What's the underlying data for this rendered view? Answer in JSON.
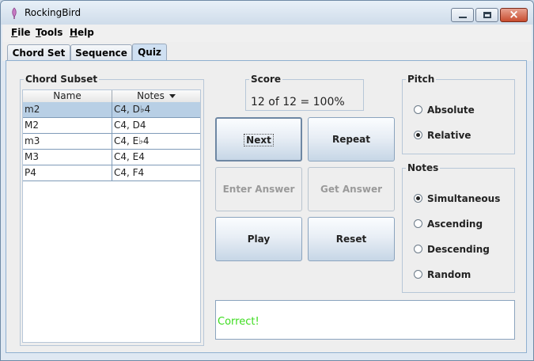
{
  "window": {
    "title": "RockingBird"
  },
  "menu": [
    {
      "label": "File",
      "mnemonic": "F",
      "rest": "ile"
    },
    {
      "label": "Tools",
      "mnemonic": "T",
      "rest": "ools"
    },
    {
      "label": "Help",
      "mnemonic": "H",
      "rest": "elp"
    }
  ],
  "tabs": [
    {
      "label": "Chord Set",
      "active": false
    },
    {
      "label": "Sequence",
      "active": false
    },
    {
      "label": "Quiz",
      "active": true
    }
  ],
  "chord_subset": {
    "title": "Chord Subset",
    "columns": {
      "name": "Name",
      "notes": "Notes"
    },
    "rows": [
      {
        "name": "m2",
        "notes": "C4, D♭4",
        "selected": true
      },
      {
        "name": "M2",
        "notes": "C4, D4",
        "selected": false
      },
      {
        "name": "m3",
        "notes": "C4, E♭4",
        "selected": false
      },
      {
        "name": "M3",
        "notes": "C4, E4",
        "selected": false
      },
      {
        "name": "P4",
        "notes": "C4, F4",
        "selected": false
      }
    ]
  },
  "score": {
    "title": "Score",
    "text": "12 of 12 = 100%"
  },
  "buttons": {
    "next": "Next",
    "repeat": "Repeat",
    "enter_answer": "Enter Answer",
    "get_answer": "Get Answer",
    "play": "Play",
    "reset": "Reset"
  },
  "pitch": {
    "title": "Pitch",
    "options": [
      {
        "label": "Absolute",
        "checked": false
      },
      {
        "label": "Relative",
        "checked": true
      }
    ]
  },
  "notes": {
    "title": "Notes",
    "options": [
      {
        "label": "Simultaneous",
        "checked": true
      },
      {
        "label": "Ascending",
        "checked": false
      },
      {
        "label": "Descending",
        "checked": false
      },
      {
        "label": "Random",
        "checked": false
      }
    ]
  },
  "message": {
    "text": "Correct!",
    "color": "#3cdc1e"
  }
}
